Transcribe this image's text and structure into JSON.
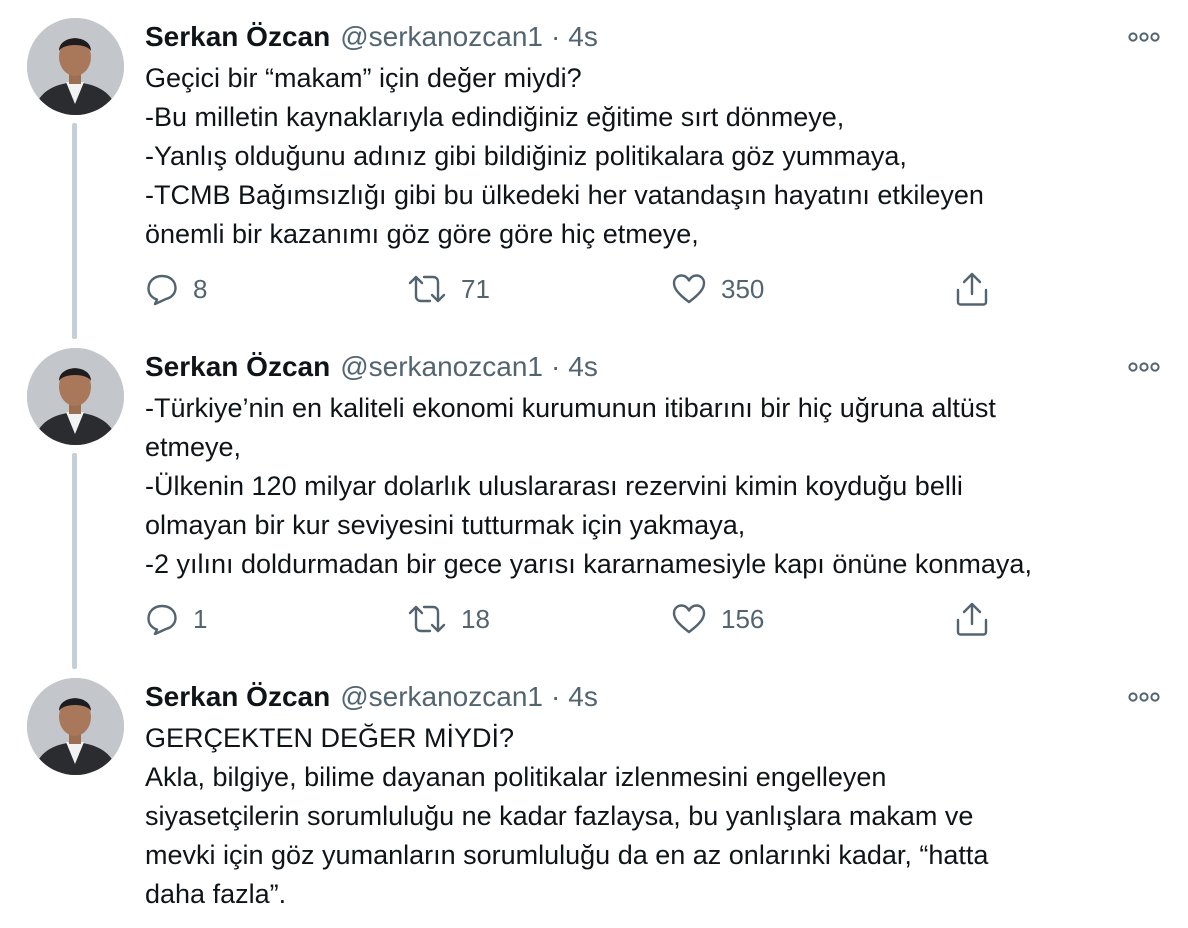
{
  "tweets": [
    {
      "author": {
        "name": "Serkan Özcan",
        "handle": "@serkanozcan1"
      },
      "separator": "·",
      "time": "4s",
      "lines": [
        "Geçici bir “makam” için değer miydi?",
        "-Bu milletin kaynaklarıyla edindiğiniz eğitime sırt dönmeye,",
        "-Yanlış olduğunu adınız gibi bildiğiniz politikalara göz yummaya,",
        "-TCMB Bağımsızlığı gibi bu ülkedeki her vatandaşın hayatını etkileyen",
        "önemli bir kazanımı göz göre göre hiç etmeye,"
      ],
      "replies": "8",
      "retweets": "71",
      "likes": "350"
    },
    {
      "author": {
        "name": "Serkan Özcan",
        "handle": "@serkanozcan1"
      },
      "separator": "·",
      "time": "4s",
      "lines": [
        "-Türkiye’nin en kaliteli ekonomi kurumunun itibarını bir hiç uğruna altüst",
        "etmeye,",
        "-Ülkenin 120 milyar dolarlık uluslararası rezervini kimin koyduğu belli",
        "olmayan bir kur seviyesini tutturmak için yakmaya,",
        "-2 yılını doldurmadan bir gece yarısı kararnamesiyle kapı önüne konmaya,"
      ],
      "replies": "1",
      "retweets": "18",
      "likes": "156"
    },
    {
      "author": {
        "name": "Serkan Özcan",
        "handle": "@serkanozcan1"
      },
      "separator": "·",
      "time": "4s",
      "lines": [
        "GERÇEKTEN DEĞER MİYDİ?",
        "Akla, bilgiye, bilime dayanan politikalar izlenmesini engelleyen",
        "siyasetçilerin sorumluluğu ne kadar fazlaysa, bu yanlışlara makam ve",
        "mevki için göz yumanların sorumluluğu da en az onlarınki kadar, “hatta",
        "daha fazla”."
      ]
    }
  ],
  "icons": {
    "more": "more-horizontal-icon",
    "reply": "reply-icon",
    "retweet": "retweet-icon",
    "like": "heart-icon",
    "share": "share-icon"
  },
  "colors": {
    "text": "#0f1419",
    "secondary": "#536471",
    "thread_line": "#c4cfd6"
  }
}
